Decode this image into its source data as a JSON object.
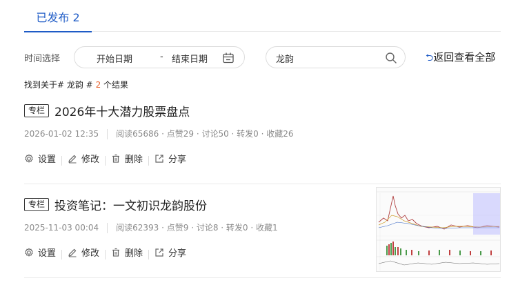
{
  "tabs": [
    {
      "label": "已发布 2",
      "active": true
    }
  ],
  "filter": {
    "label": "时间选择",
    "start_placeholder": "开始日期",
    "separator": "-",
    "end_placeholder": "结束日期",
    "calendar_icon": "calendar-icon"
  },
  "search": {
    "value": "龙韵",
    "icon": "search-icon"
  },
  "back_all": {
    "arrow": "⮌",
    "label": "返回查看全部"
  },
  "result_summary": {
    "prefix": "找到关于# 龙韵 #",
    "count": "2",
    "suffix": "个结果"
  },
  "posts": [
    {
      "tag": "专栏",
      "title": "2026年十大潜力股票盘点",
      "date": "2026-01-02 12:35",
      "stats": "阅读65686 · 点赞29 · 讨论50 · 转发0 · 收藏26",
      "actions": {
        "settings": "设置",
        "edit": "修改",
        "delete": "删除",
        "share": "分享"
      }
    },
    {
      "tag": "专栏",
      "title": "投资笔记：一文初识龙韵股份",
      "date": "2025-11-03 00:04",
      "stats": "阅读62393 · 点赞9 · 讨论8 · 转发0 · 收藏1",
      "actions": {
        "settings": "设置",
        "edit": "修改",
        "delete": "删除",
        "share": "分享"
      },
      "has_thumbnail": true
    }
  ],
  "colors": {
    "accent": "#1e5bc6",
    "count": "#e8612c"
  }
}
